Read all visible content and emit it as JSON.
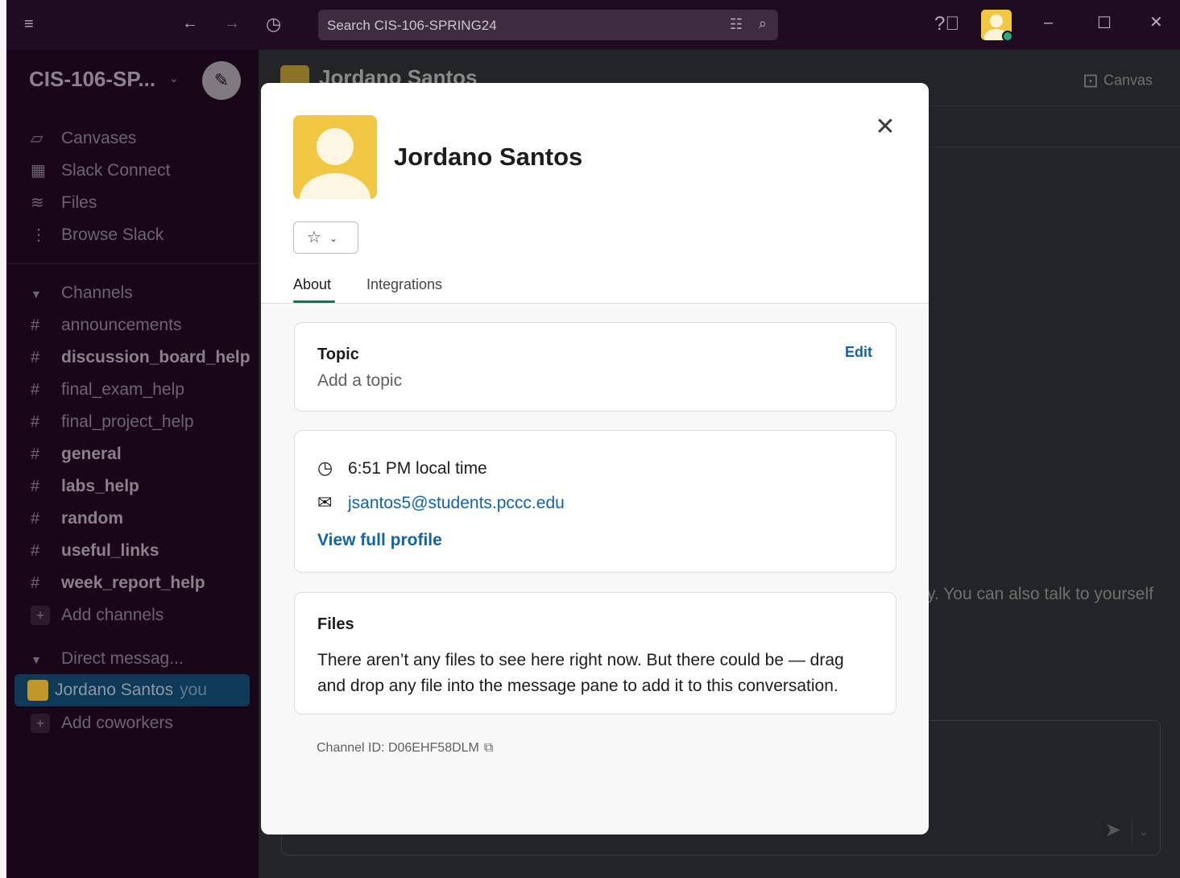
{
  "titlebar": {
    "search_placeholder": "Search CIS-106-SPRING24",
    "help_icon": "help-circle-icon"
  },
  "sidebar": {
    "workspace": "CIS-106-SP...",
    "nav": [
      {
        "label": "Canvases",
        "icon": "canvas-icon"
      },
      {
        "label": "Slack Connect",
        "icon": "building-icon"
      },
      {
        "label": "Files",
        "icon": "layers-icon"
      },
      {
        "label": "Browse Slack",
        "icon": "kebab-icon"
      }
    ],
    "channels_header": "Channels",
    "channels": [
      {
        "name": "announcements",
        "bold": false
      },
      {
        "name": "discussion_board_help",
        "bold": true
      },
      {
        "name": "final_exam_help",
        "bold": false
      },
      {
        "name": "final_project_help",
        "bold": false
      },
      {
        "name": "general",
        "bold": true
      },
      {
        "name": "labs_help",
        "bold": true
      },
      {
        "name": "random",
        "bold": true
      },
      {
        "name": "useful_links",
        "bold": true
      },
      {
        "name": "week_report_help",
        "bold": true
      }
    ],
    "add_channels": "Add channels",
    "dm_header": "Direct messag...",
    "dm_user": "Jordano Santos",
    "dm_you": "you",
    "add_coworkers": "Add coworkers"
  },
  "main": {
    "title": "Jordano Santos",
    "canvas_label": "Canvas",
    "bg_text": "y. You can also talk to yourself"
  },
  "modal": {
    "name": "Jordano Santos",
    "tabs": [
      "About",
      "Integrations"
    ],
    "topic": {
      "heading": "Topic",
      "edit": "Edit",
      "text": "Add a topic"
    },
    "local_time": "6:51 PM local time",
    "email": "jsantos5@students.pccc.edu",
    "view_profile": "View full profile",
    "files": {
      "heading": "Files",
      "text": "There aren’t any files to see here right now. But there could be — drag and drop any file into the message pane to add it to this conversation."
    },
    "channel_id": "Channel ID: D06EHF58DLM"
  },
  "colors": {
    "sidebar_bg": "#190719",
    "titlebar_bg": "#1f0b22",
    "accent_green": "#007a5a",
    "link_blue": "#1264a3",
    "avatar_yellow": "#f2c744"
  }
}
